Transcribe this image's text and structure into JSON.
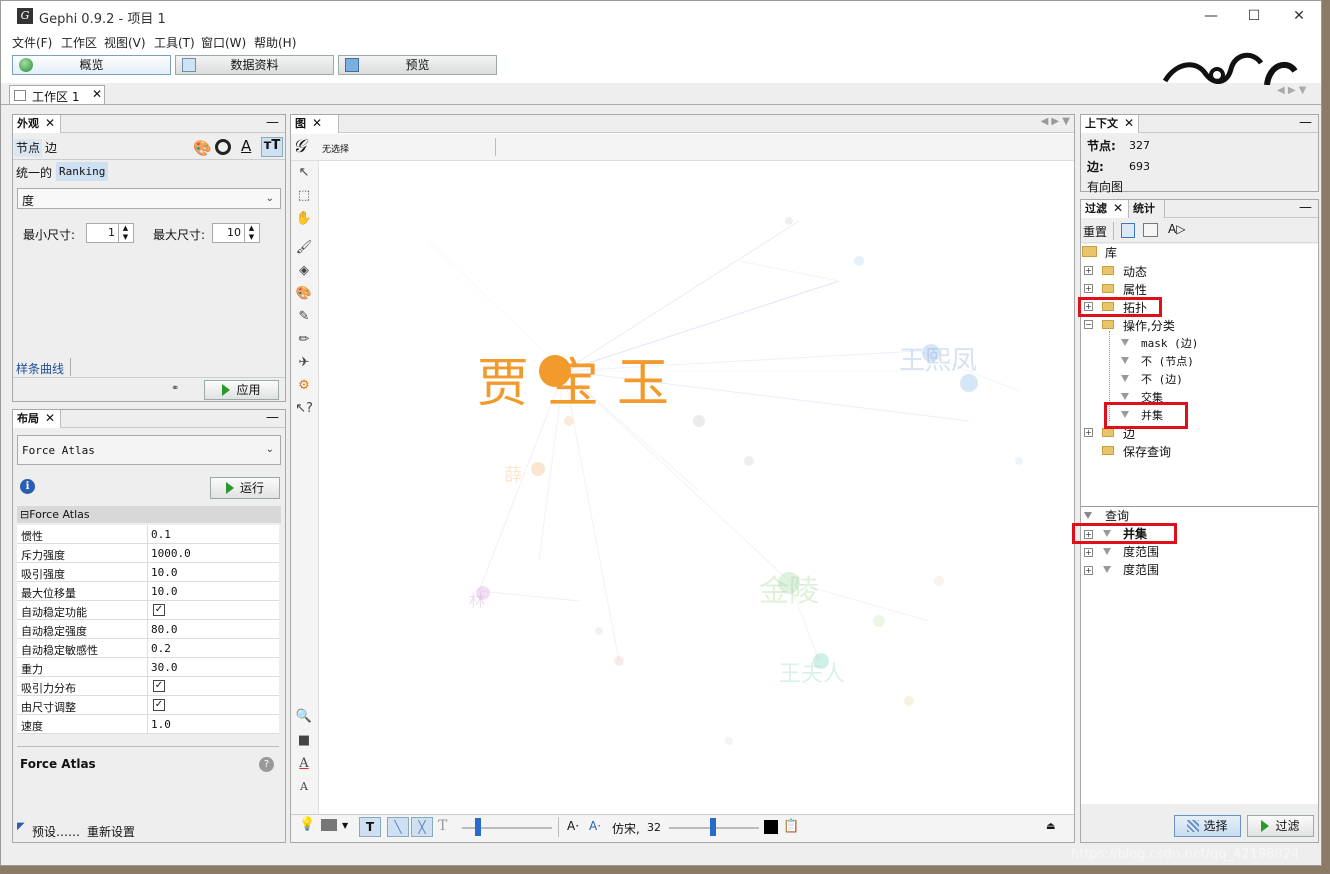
{
  "app": {
    "title": "Gephi 0.9.2 - 项目 1"
  },
  "menu": [
    "文件(F)",
    "工作区",
    "视图(V)",
    "工具(T)",
    "窗口(W)",
    "帮助(H)"
  ],
  "main_tabs": [
    "概览",
    "数据资料",
    "预览"
  ],
  "workspace_tab": "工作区 1",
  "appearance": {
    "tab": "外观",
    "sub_tabs": [
      "节点",
      "边"
    ],
    "modes": [
      "统一的",
      "Ranking"
    ],
    "attribute": "度",
    "min_label": "最小尺寸:",
    "min_value": "1",
    "max_label": "最大尺寸:",
    "max_value": "10",
    "spline_link": "样条曲线",
    "apply": "应用"
  },
  "layout": {
    "tab": "布局",
    "algorithm": "Force Atlas",
    "run": "运行",
    "group": "Force Atlas",
    "props": [
      {
        "k": "惯性",
        "v": "0.1"
      },
      {
        "k": "斥力强度",
        "v": "1000.0"
      },
      {
        "k": "吸引强度",
        "v": "10.0"
      },
      {
        "k": "最大位移量",
        "v": "10.0"
      },
      {
        "k": "自动稳定功能",
        "v": "",
        "checked": true
      },
      {
        "k": "自动稳定强度",
        "v": "80.0"
      },
      {
        "k": "自动稳定敏感性",
        "v": "0.2"
      },
      {
        "k": "重力",
        "v": "30.0"
      },
      {
        "k": "吸引力分布",
        "v": "",
        "checked": true
      },
      {
        "k": "由尺寸调整",
        "v": "",
        "checked": true
      },
      {
        "k": "速度",
        "v": "1.0"
      }
    ],
    "desc_title": "Force Atlas",
    "presets": "预设……",
    "reset": "重新设置"
  },
  "graph": {
    "tab": "图",
    "selection": "无选择",
    "labels": [
      "贾宝玉",
      "王熙凤",
      "金陵",
      "王夫人"
    ],
    "font_name": "仿宋,",
    "font_size": "32"
  },
  "context": {
    "tab": "上下文",
    "nodes_label": "节点:",
    "nodes": "327",
    "edges_label": "边:",
    "edges": "693",
    "type": "有向图"
  },
  "filters": {
    "tabs": [
      "过滤",
      "统计"
    ],
    "reset": "重置",
    "library": "库",
    "tree": [
      "动态",
      "属性",
      "拓扑",
      "操作,分类",
      "mask (边)",
      "不 (节点)",
      "不 (边)",
      "交集",
      "并集",
      "边",
      "保存查询"
    ],
    "queries_label": "查询",
    "queries": [
      "并集",
      "度范围",
      "度范围"
    ],
    "select_btn": "选择",
    "filter_btn": "过滤"
  },
  "watermark": "https://blog.csdn.net/qq_42198024"
}
